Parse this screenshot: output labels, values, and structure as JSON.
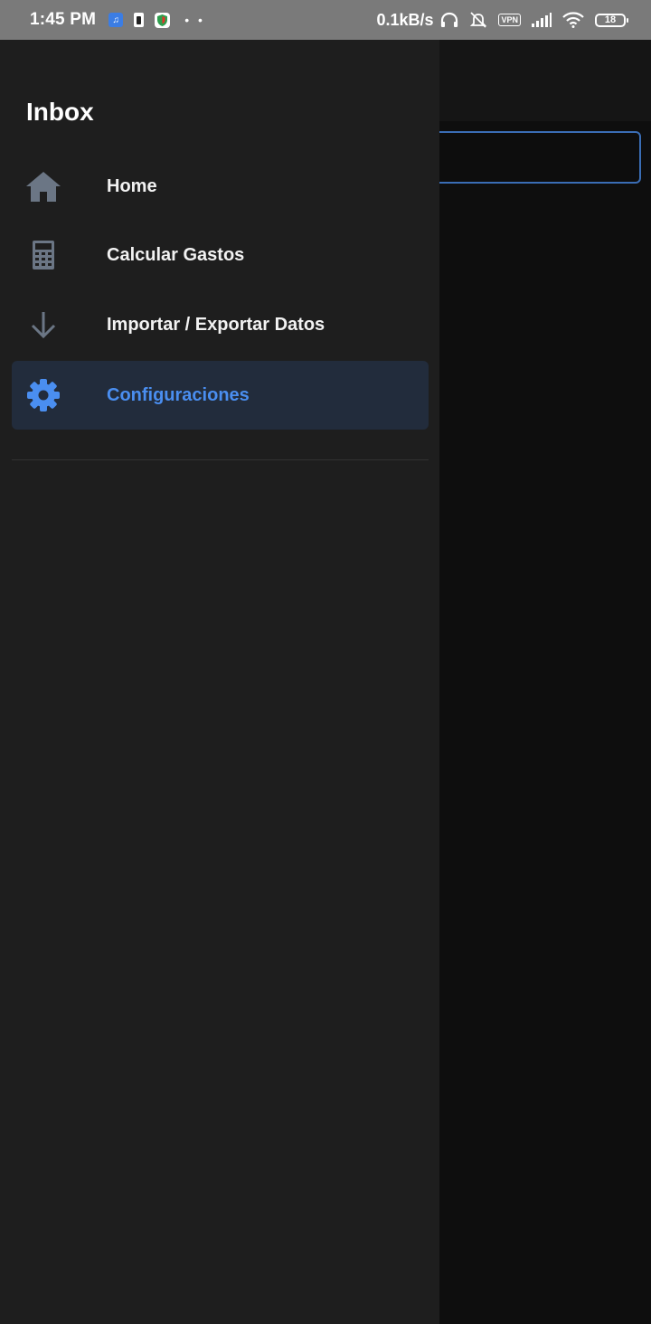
{
  "status_bar": {
    "time": "1:45 PM",
    "speed": "0.1kB/s",
    "vpn": "VPN",
    "battery": "18",
    "icons": [
      "music-app-icon",
      "sim-card-icon",
      "shield-app-icon",
      "more-dots-icon",
      "headphones-icon",
      "alarm-off-icon",
      "vpn-icon",
      "signal-icon",
      "wifi-icon",
      "battery-icon"
    ]
  },
  "drawer": {
    "title": "Inbox",
    "items": [
      {
        "label": "Home",
        "icon": "home-icon",
        "active": false
      },
      {
        "label": "Calcular Gastos",
        "icon": "calculator-icon",
        "active": false
      },
      {
        "label": "Importar / Exportar Datos",
        "icon": "arrow-down-icon",
        "active": false
      },
      {
        "label": "Configuraciones",
        "icon": "gear-icon",
        "active": true
      }
    ]
  },
  "colors": {
    "accent": "#4a8ef0",
    "drawer_bg": "#1e1e1e",
    "active_bg": "#222c3c",
    "icon_gray": "#6b7685",
    "status_bar_bg": "#7a7a7a"
  }
}
